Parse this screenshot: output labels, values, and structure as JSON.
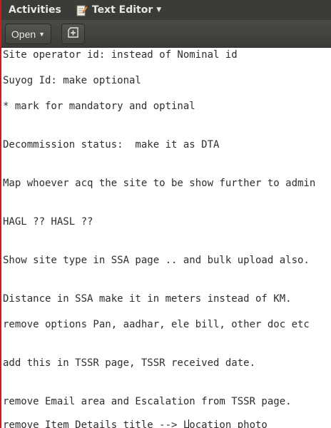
{
  "top_panel": {
    "activities_label": "Activities",
    "app_name": "Text Editor",
    "app_icon": "text-editor-icon"
  },
  "header_bar": {
    "open_label": "Open",
    "new_tab_icon": "new-tab-icon"
  },
  "document": {
    "lines": [
      "Site operator id: instead of Nominal id",
      "Suyog Id: make optional",
      "* mark for mandatory and optinal",
      "Decommission status:  make it as DTA",
      "Map whoever acq the site to be show further to admin",
      "HAGL ?? HASL ??",
      "Show site type in SSA page .. and bulk upload also.",
      "Distance in SSA make it in meters instead of KM.",
      "remove options Pan, aadhar, ele bill, other doc etc",
      "add this in TSSR page, TSSR received date.",
      "remove Email area and Escalation from TSSR page.",
      "remove Item Details title --> Location photo"
    ]
  }
}
